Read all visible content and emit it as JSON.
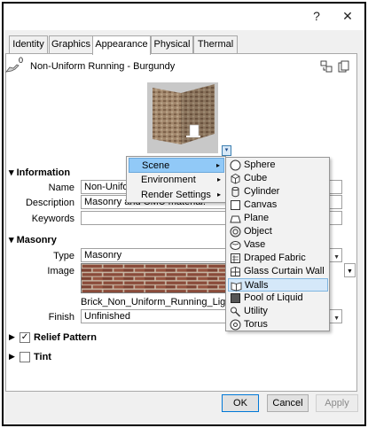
{
  "window": {
    "help": "?",
    "close": "✕"
  },
  "tabs": [
    "Identity",
    "Graphics",
    "Appearance",
    "Physical",
    "Thermal"
  ],
  "header": {
    "badge": "0",
    "title": "Non-Uniform Running - Burgundy"
  },
  "information": {
    "section": "Information",
    "name_label": "Name",
    "name_value": "Non-Unifo",
    "description_label": "Description",
    "description_value": "Masonry and CMU material.",
    "keywords_label": "Keywords",
    "keywords_value": ""
  },
  "masonry": {
    "section": "Masonry",
    "type_label": "Type",
    "type_value": "Masonry",
    "image_label": "Image",
    "image_file": "Brick_Non_Uniform_Running_Light.pn",
    "finish_label": "Finish",
    "finish_value": "Unfinished"
  },
  "relief": {
    "label": "Relief Pattern",
    "checked": true
  },
  "tint": {
    "label": "Tint",
    "checked": false
  },
  "buttons": {
    "ok": "OK",
    "cancel": "Cancel",
    "apply": "Apply"
  },
  "menu": {
    "items": [
      {
        "label": "Scene",
        "highlighted": true
      },
      {
        "label": "Environment",
        "highlighted": false
      },
      {
        "label": "Render Settings",
        "highlighted": false
      }
    ],
    "submenu_arrow": "▸"
  },
  "submenu": {
    "items": [
      {
        "label": "Sphere",
        "icon": "sphere-icon"
      },
      {
        "label": "Cube",
        "icon": "cube-icon"
      },
      {
        "label": "Cylinder",
        "icon": "cylinder-icon"
      },
      {
        "label": "Canvas",
        "icon": "canvas-icon"
      },
      {
        "label": "Plane",
        "icon": "plane-icon"
      },
      {
        "label": "Object",
        "icon": "object-icon"
      },
      {
        "label": "Vase",
        "icon": "vase-icon"
      },
      {
        "label": "Draped Fabric",
        "icon": "draped-fabric-icon"
      },
      {
        "label": "Glass Curtain Wall",
        "icon": "glass-curtain-wall-icon"
      },
      {
        "label": "Walls",
        "icon": "walls-icon",
        "highlighted": true
      },
      {
        "label": "Pool of Liquid",
        "icon": "pool-of-liquid-icon"
      },
      {
        "label": "Utility",
        "icon": "utility-icon"
      },
      {
        "label": "Torus",
        "icon": "torus-icon"
      }
    ]
  },
  "colors": {
    "accent": "#0078d7",
    "menu_highlight": "#91c9f7",
    "brick": "#8b4a3a"
  }
}
